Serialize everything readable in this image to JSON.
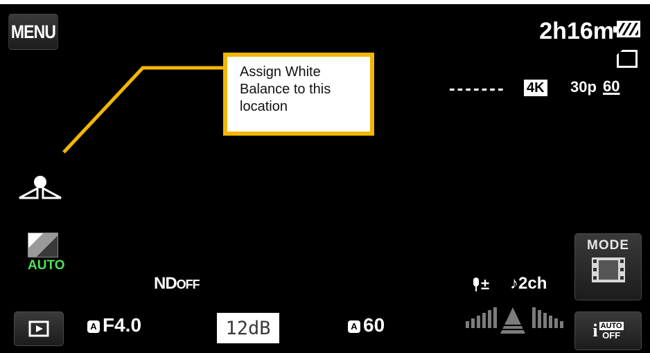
{
  "top_left": {
    "menu_label": "MENU"
  },
  "status": {
    "record_time": "2h16m",
    "battery_icon": "battery-full-icon",
    "card_icon": "memory-card-icon",
    "dashes": "-------",
    "format_badge": "4K",
    "frame_rate": "30p",
    "shutter_marker": "60"
  },
  "callout": {
    "text": "Assign White Balance to this location",
    "border_color": "#f2b705",
    "line_color": "#f2b705"
  },
  "left_icons": {
    "eye_icon": "eye-face-icon",
    "dro_icon": "dro-icon",
    "dro_label": "AUTO"
  },
  "middle": {
    "nd_label": "ND",
    "nd_value": "OFF",
    "mic_label": "±",
    "audio_label": "♪2ch"
  },
  "bottom": {
    "playback_icon": "playback-icon",
    "aperture_badge": "A",
    "aperture": "F4.0",
    "gain": "12dB",
    "shutter_badge": "A",
    "shutter": "60",
    "iauto_top": "AUTO",
    "iauto_bottom": "OFF"
  },
  "right_buttons": {
    "mode_label": "MODE",
    "mode_icon": "film-icon"
  },
  "colors": {
    "dro_auto": "#49e35a",
    "background": "#000000"
  }
}
